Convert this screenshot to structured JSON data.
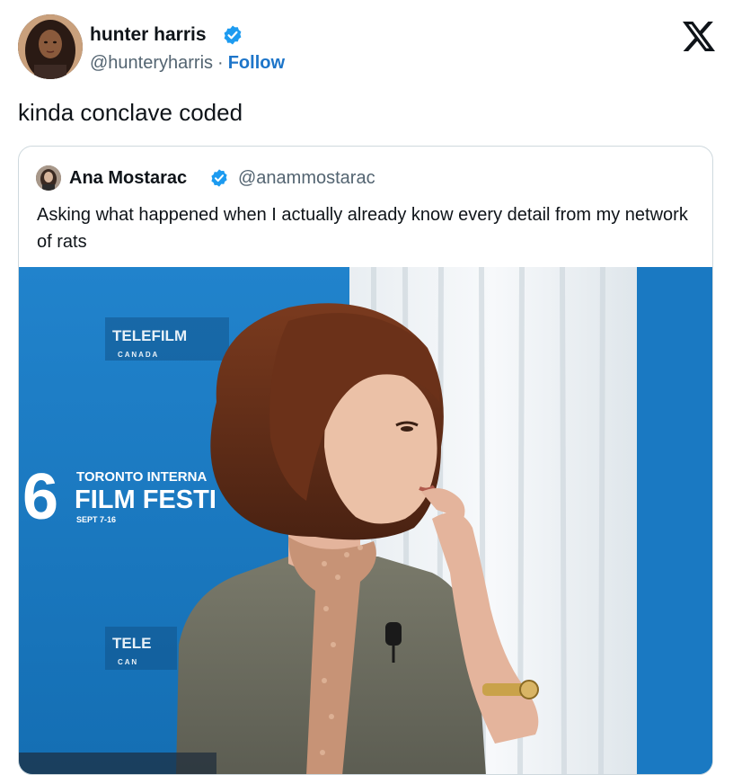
{
  "author": {
    "name": "hunter harris",
    "handle": "@hunteryharris",
    "separator": "·",
    "follow_label": "Follow",
    "verified": true
  },
  "brand_icon": "x-logo-icon",
  "tweet": {
    "text": "kinda conclave coded"
  },
  "quoted": {
    "name": "Ana Mostarac",
    "handle": "@anammostarac",
    "verified": true,
    "text": "Asking what happened when I actually already know every detail from my network of rats",
    "media": {
      "backdrop_text": {
        "logo1_line1": "TELEFILM",
        "logo1_line2": "C A N A D A",
        "festival_number": "6",
        "festival_line1": "TORONTO INTERNA",
        "festival_line2": "FILM FESTI",
        "festival_dates": "SEPT 7-16",
        "logo2_line1": "TELE",
        "logo2_line2": "C A N"
      }
    }
  },
  "colors": {
    "verified_blue": "#1d9bf0",
    "follow_blue": "#1d75c9",
    "backdrop_blue": "#1a7bc4"
  }
}
